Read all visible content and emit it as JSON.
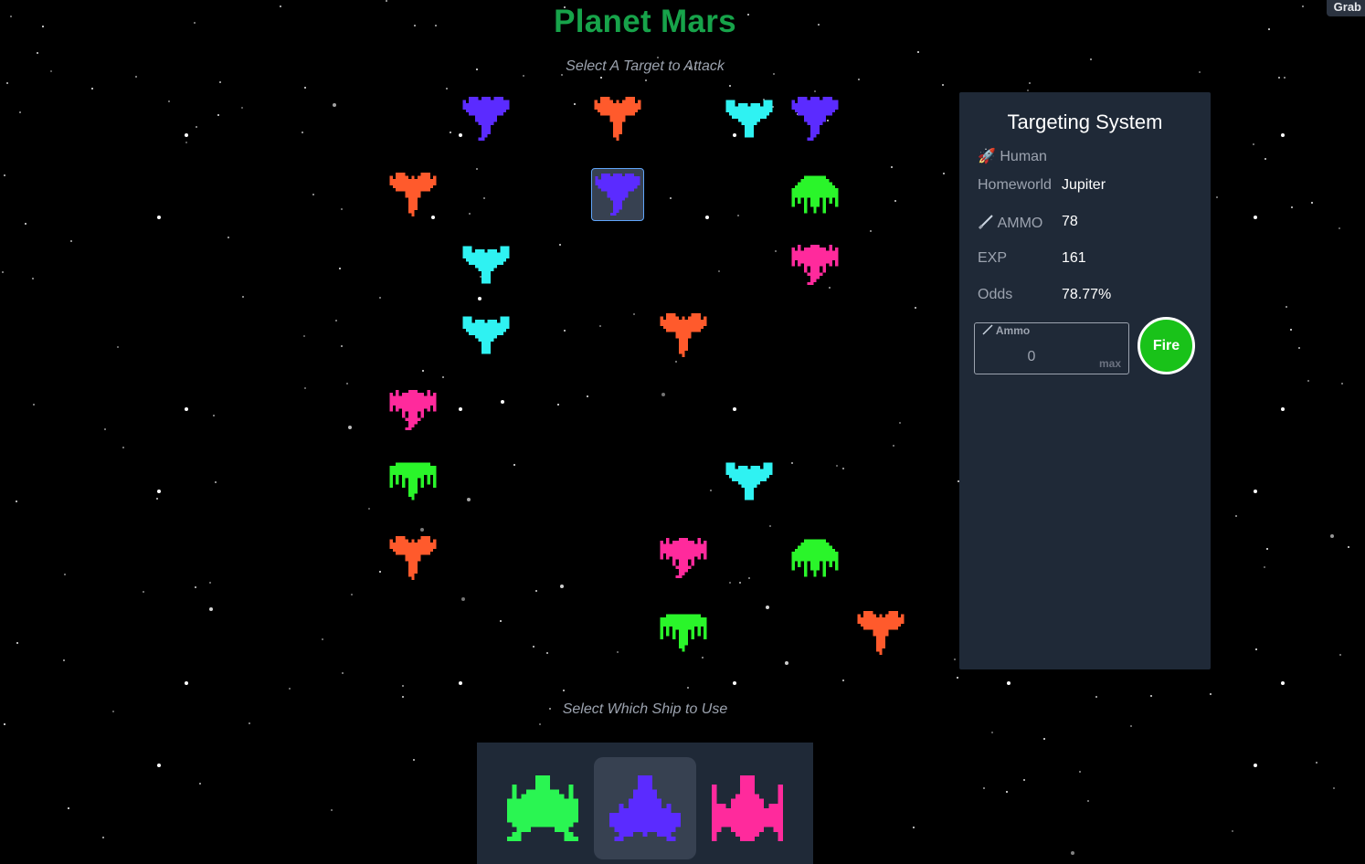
{
  "page_title": "Planet Mars",
  "target_prompt": "Select A Target to Attack",
  "ship_prompt": "Select Which Ship to Use",
  "corner_tab": "Grab",
  "enemies": [
    {
      "design": "v1",
      "color": "#5b2bff"
    },
    {
      "design": "v2",
      "color": "#ff5a2c"
    },
    {
      "design": "v3",
      "color": "#2ff2f2"
    },
    {
      "design": "v1",
      "color": "#5b2bff"
    },
    {
      "design": "v2",
      "color": "#ff5a2c"
    },
    {
      "design": "v1",
      "color": "#5b2bff",
      "selected": true
    },
    {
      "design": "v4",
      "color": "#2af52a"
    },
    {
      "design": "v3",
      "color": "#2ff2f2"
    },
    {
      "design": "v5",
      "color": "#ff2a9c"
    },
    {
      "design": "v3",
      "color": "#2ff2f2"
    },
    {
      "design": "v2",
      "color": "#ff5a2c"
    },
    {
      "design": "v5",
      "color": "#ff2a9c"
    },
    {
      "design": "v6",
      "color": "#2af52a"
    },
    {
      "design": "v3",
      "color": "#2ff2f2"
    },
    {
      "design": "v2",
      "color": "#ff5a2c"
    },
    {
      "design": "v5",
      "color": "#ff2a9c"
    },
    {
      "design": "v4",
      "color": "#2af52a"
    },
    {
      "design": "v6",
      "color": "#2af52a"
    },
    {
      "design": "v2",
      "color": "#ff5a2c"
    }
  ],
  "targeting": {
    "title": "Targeting System",
    "race_icon": "🚀",
    "race": "Human",
    "homeworld_label": "Homeworld",
    "homeworld": "Jupiter",
    "ammo_icon": "missile-icon",
    "ammo_label": "AMMO",
    "ammo": "78",
    "exp_label": "EXP",
    "exp": "161",
    "odds_label": "Odds",
    "odds": "78.77%",
    "ammo_input_label": "Ammo",
    "ammo_input_value": "0",
    "max_label": "max",
    "fire_label": "Fire"
  },
  "player_ships": [
    {
      "design": "p1",
      "color": "#2af552",
      "selected": false
    },
    {
      "design": "p2",
      "color": "#5b2bff",
      "selected": true
    },
    {
      "design": "p3",
      "color": "#ff2a9c",
      "selected": false
    }
  ]
}
